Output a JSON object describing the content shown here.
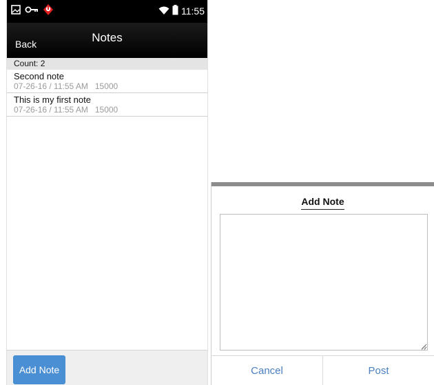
{
  "status_bar": {
    "left_icons": [
      "image-icon",
      "key-icon",
      "alert-badge-icon"
    ],
    "right_icons": [
      "wifi-icon",
      "battery-icon"
    ],
    "time": "11:55"
  },
  "nav": {
    "back_label": "Back",
    "title": "Notes"
  },
  "list": {
    "count_label": "Count:  2",
    "notes": [
      {
        "title": "Second note",
        "meta": "07-26-16 / 11:55 AM   15000"
      },
      {
        "title": "This is my first note",
        "meta": "07-26-16 / 11:55 AM   15000"
      }
    ]
  },
  "footer": {
    "add_note_label": "Add Note"
  },
  "dialog": {
    "title": "Add Note",
    "textarea_value": "",
    "cancel_label": "Cancel",
    "post_label": "Post"
  },
  "colors": {
    "accent": "#4a8fd4",
    "dialog_action": "#4a7fc0",
    "alert_badge": "#e02020"
  }
}
